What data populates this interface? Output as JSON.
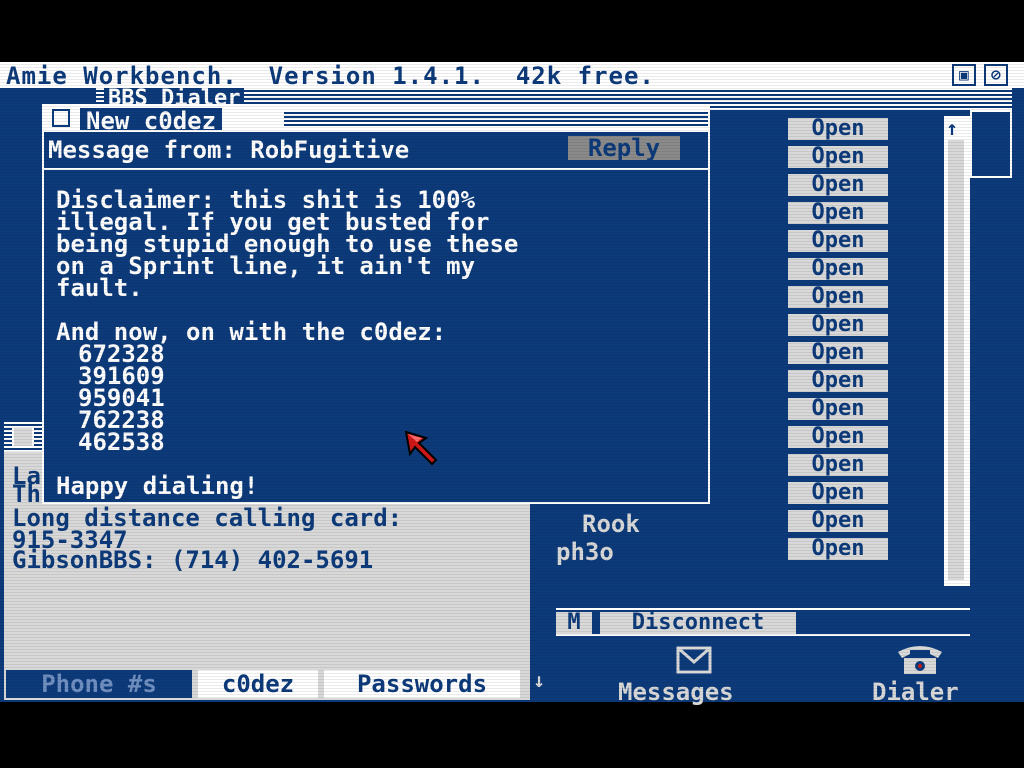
{
  "screen_title": "Amie Workbench.  Version 1.4.1.  42k free.",
  "bbs_window": {
    "title": "BBS Dialer",
    "open_label": "Open",
    "usernames": [
      "Rook",
      "ph3o"
    ],
    "m_label": "M",
    "disconnect_label": "Disconnect"
  },
  "notes_window": {
    "lines": [
      "La",
      "Th",
      "Long distance calling card:",
      " 915-3347",
      "GibsonBBS: (714) 402-5691"
    ],
    "tabs": [
      "Phone #s",
      "c0dez",
      "Passwords"
    ]
  },
  "message_window": {
    "title": "New c0dez",
    "header": "Message from: RobFugitive",
    "reply_label": "Reply",
    "body_lines": [
      "Disclaimer: this shit is 100%",
      "illegal. If you get busted for",
      "being stupid enough to use these",
      "on a Sprint line, it ain't my",
      "fault."
    ],
    "codes_intro": "And now, on with the c0dez:",
    "codes": [
      "672328",
      "391609",
      "959041",
      "762238",
      "462538"
    ],
    "signoff": "Happy dialing!"
  },
  "dock": {
    "messages_label": "Messages",
    "dialer_label": "Dialer"
  },
  "colors": {
    "background": "#0d3a7a",
    "white": "#ffffff",
    "light_gray": "#d8d8d8",
    "cursor_red": "#d01818"
  }
}
